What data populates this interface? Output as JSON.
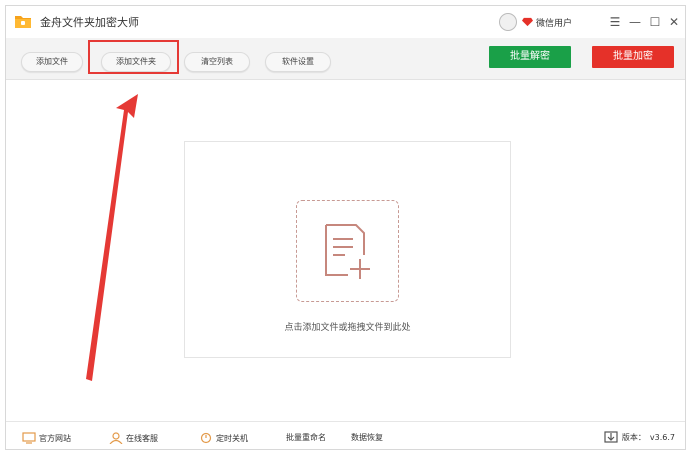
{
  "window": {
    "title": "金舟文件夹加密大师",
    "user_label": "微信用户",
    "controls": {
      "menu": "☰",
      "minimize": "—",
      "maximize": "☐",
      "close": "✕"
    }
  },
  "toolbar": {
    "add_file": "添加文件",
    "add_folder": "添加文件夹",
    "clear_list": "清空列表",
    "settings": "软件设置",
    "batch_decrypt": "批量解密",
    "batch_encrypt": "批量加密"
  },
  "drop_zone": {
    "hint": "点击添加文件或拖拽文件到此处"
  },
  "footer": {
    "website": "官方网站",
    "support": "在线客服",
    "shutdown": "定时关机",
    "rename": "批量重命名",
    "recovery": "数据恢复",
    "version_label": "版本：",
    "version": "v3.6.7"
  },
  "colors": {
    "decrypt": "#1aa048",
    "encrypt": "#e53129",
    "highlight": "#e53935",
    "logo": "#f6a21b"
  },
  "icons": [
    "folder-logo-icon",
    "avatar-icon",
    "gem-icon",
    "document-add-icon",
    "monitor-icon",
    "person-icon",
    "timer-icon",
    "download-icon"
  ]
}
